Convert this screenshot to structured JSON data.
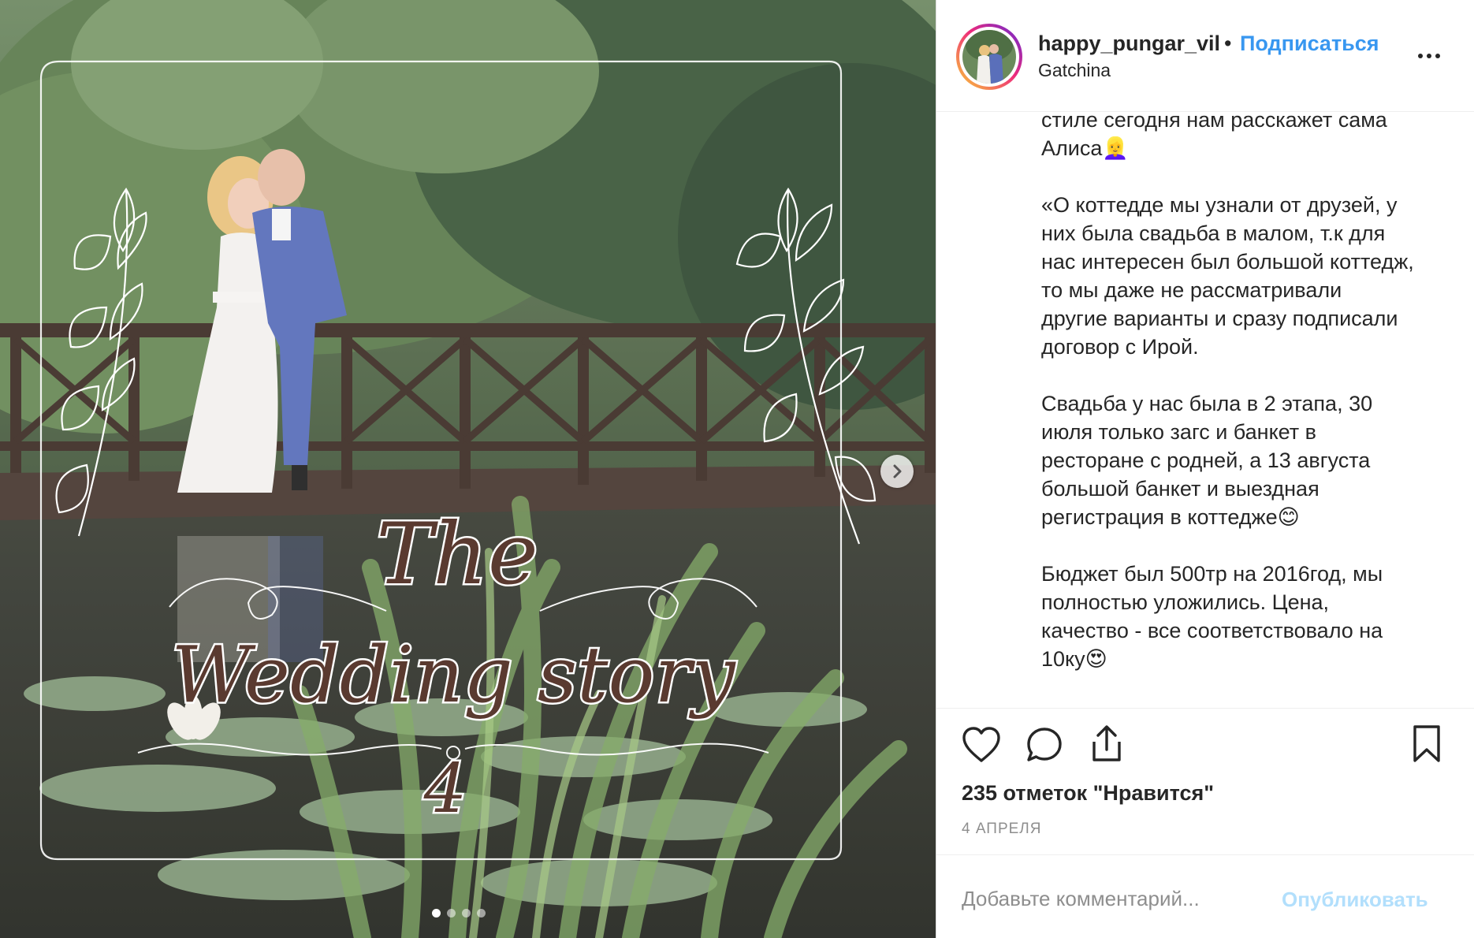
{
  "post": {
    "username": "happy_pungar_vil",
    "separator": "•",
    "follow_label": "Подписаться",
    "location": "Gatchina",
    "caption_paragraphs": [
      "стиле сегодня нам расскажет сама\nАлиса👱‍♀️",
      "«О коттедде мы узнали от друзей, у\nних была свадьба в малом, т.к для\nнас интересен был большой коттедж,\nто мы даже не рассматривали\nдругие варианты и сразу подписали\nдоговор с Ирой.",
      "Свадьба у нас была в 2 этапа, 30\nиюля только загс и банкет в\nресторане с родней, а 13 августа\nбольшой банкет и выездная\nрегистрация в коттедже😊",
      "Бюджет был 500тр на 2016год, мы\nполностью уложились. Цена,\nкачество - все соответствовало на\n10ку😍"
    ],
    "likes_text": "235 отметок \"Нравится\"",
    "date_text": "4 АПРЕЛЯ",
    "comment_placeholder": "Добавьте комментарий...",
    "publish_label": "Опубликовать"
  },
  "media": {
    "overlay_title_line1": "The",
    "overlay_title_line2": "Wedding story",
    "overlay_number": "4",
    "carousel_total": 4,
    "carousel_active": 1
  },
  "icons": {
    "like": "heart-icon",
    "comment": "comment-icon",
    "share": "share-icon",
    "save": "bookmark-icon",
    "more": "more-options-icon",
    "next": "chevron-right-icon"
  },
  "colors": {
    "follow_blue": "#3897f0",
    "publish_disabled": "#b2dffc",
    "muted_text": "#8e8e8e"
  }
}
